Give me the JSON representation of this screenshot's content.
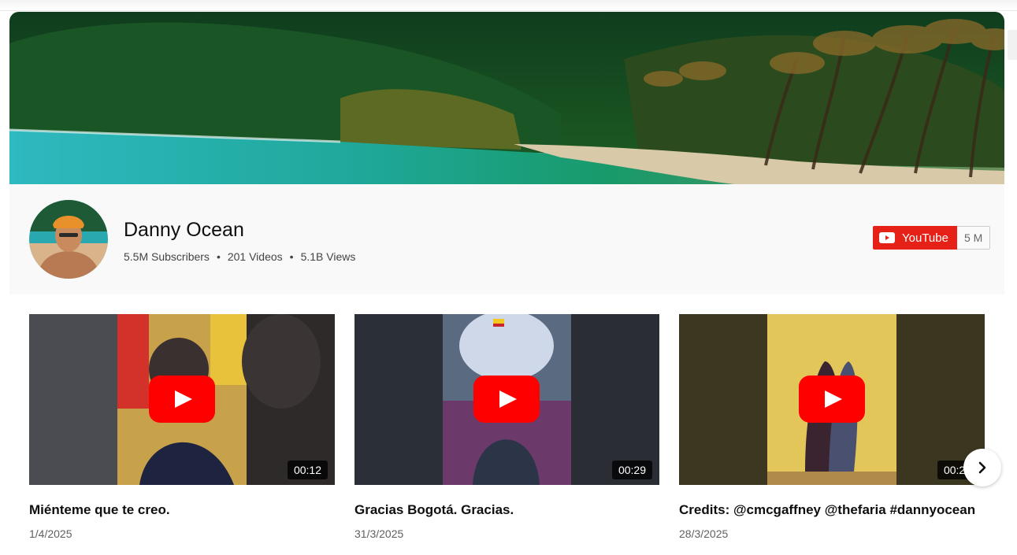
{
  "channel": {
    "name": "Danny Ocean",
    "subscribers": "5.5M Subscribers",
    "videos": "201 Videos",
    "views": "5.1B Views",
    "separator": "•"
  },
  "subscribe": {
    "label": "YouTube",
    "count": "5 M"
  },
  "videos": [
    {
      "title": "Miénteme que te creo.",
      "date": "1/4/2025",
      "duration": "00:12"
    },
    {
      "title": "Gracias Bogotá. Gracias.",
      "date": "31/3/2025",
      "duration": "00:29"
    },
    {
      "title": "Credits: @cmcgaffney @thefaria #dannyocean",
      "date": "28/3/2025",
      "duration": "00:29"
    }
  ],
  "icons": {
    "play": "youtube-play-icon",
    "next": "chevron-right-icon",
    "logo": "youtube-logo-icon"
  },
  "colors": {
    "youtube_red": "#e62117",
    "play_red": "#ff0000"
  }
}
